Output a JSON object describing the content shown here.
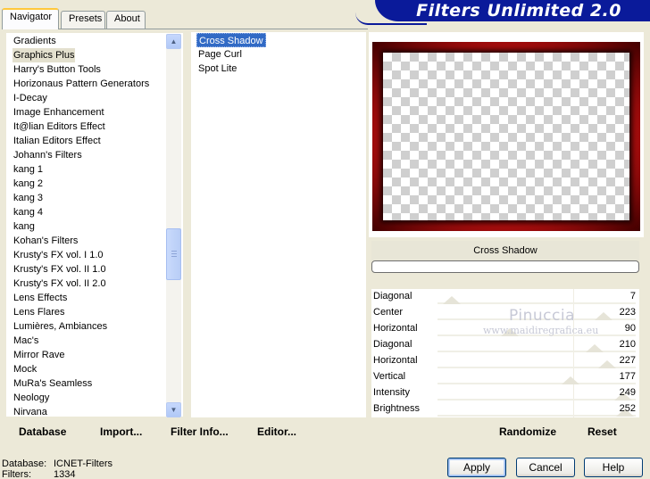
{
  "banner": {
    "title": "Filters Unlimited 2.0"
  },
  "tabs": [
    {
      "label": "Navigator",
      "active": true
    },
    {
      "label": "Presets",
      "active": false
    },
    {
      "label": "About",
      "active": false
    }
  ],
  "categories": {
    "items": [
      "Gradients",
      "Graphics Plus",
      "Harry's Button Tools",
      "Horizonaus Pattern Generators",
      "I-Decay",
      "Image Enhancement",
      "It@lian Editors Effect",
      "Italian Editors Effect",
      "Johann's Filters",
      "kang 1",
      "kang 2",
      "kang 3",
      "kang 4",
      "kang",
      "Kohan's Filters",
      "Krusty's FX vol. I 1.0",
      "Krusty's FX vol. II 1.0",
      "Krusty's FX vol. II 2.0",
      "Lens Effects",
      "Lens Flares",
      "Lumières, Ambiances",
      "Mac's",
      "Mirror Rave",
      "Mock",
      "MuRa's Seamless",
      "Neology",
      "Nirvana"
    ],
    "selected": "Graphics Plus"
  },
  "effects": {
    "items": [
      "Cross Shadow",
      "Page Curl",
      "Spot Lite"
    ],
    "selected": "Cross Shadow"
  },
  "preview": {
    "effect_name": "Cross Shadow"
  },
  "sliders": [
    {
      "label": "Diagonal",
      "value": "7",
      "level": 0.03
    },
    {
      "label": "Center",
      "value": "223",
      "level": 0.87
    },
    {
      "label": "Horizontal",
      "value": "90",
      "level": 0.35
    },
    {
      "label": "Diagonal",
      "value": "210",
      "level": 0.82
    },
    {
      "label": "Horizontal",
      "value": "227",
      "level": 0.89
    },
    {
      "label": "Vertical",
      "value": "177",
      "level": 0.69
    },
    {
      "label": "Intensity",
      "value": "249",
      "level": 0.98
    },
    {
      "label": "Brightness",
      "value": "252",
      "level": 0.99
    }
  ],
  "watermark": {
    "name": "Pinuccia",
    "site": "www.maidiregrafica.eu"
  },
  "toolbar": {
    "database": "Database",
    "import": "Import...",
    "filter_info": "Filter Info...",
    "editor": "Editor...",
    "randomize": "Randomize",
    "reset": "Reset"
  },
  "status": {
    "database_label": "Database:",
    "database_value": "ICNET-Filters",
    "filters_label": "Filters:",
    "filters_value": "1334"
  },
  "buttons": {
    "apply": "Apply",
    "cancel": "Cancel",
    "help": "Help"
  }
}
